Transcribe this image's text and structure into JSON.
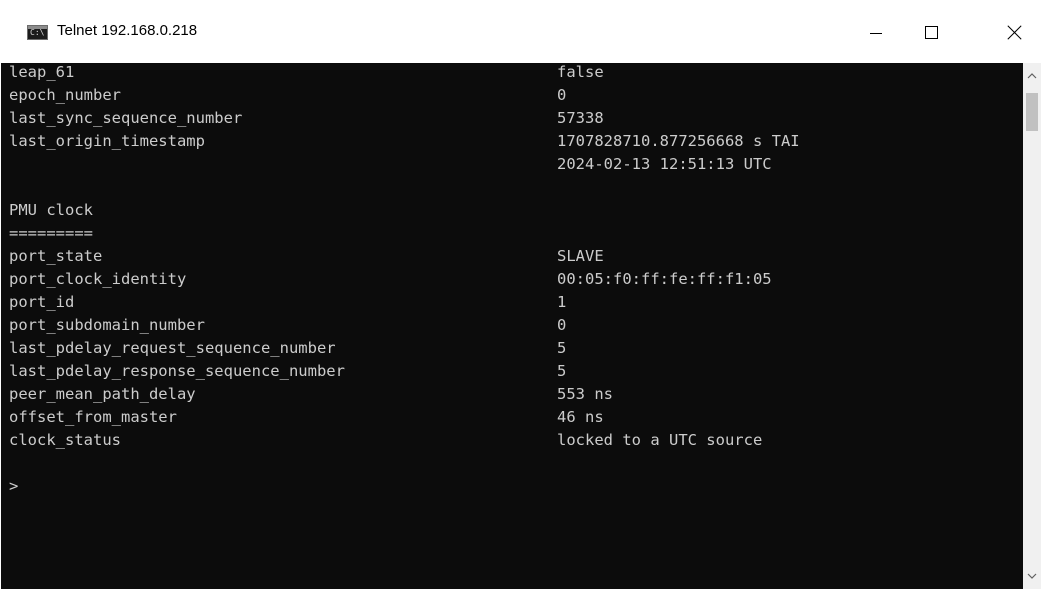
{
  "window": {
    "title": "Telnet 192.168.0.218",
    "icon": "console-icon",
    "icon_label": "C:\\"
  },
  "console": {
    "background": "#0c0c0c",
    "foreground": "#cccccc",
    "rows": [
      {
        "key": "leap_61",
        "value": "false"
      },
      {
        "key": "epoch_number",
        "value": "0"
      },
      {
        "key": "last_sync_sequence_number",
        "value": "57338"
      },
      {
        "key": "last_origin_timestamp",
        "value": "1707828710.877256668 s TAI"
      },
      {
        "key": "",
        "value": "2024-02-13 12:51:13 UTC"
      },
      {
        "key": "",
        "value": ""
      },
      {
        "key": "PMU clock",
        "value": ""
      },
      {
        "key": "=========",
        "value": ""
      },
      {
        "key": "port_state",
        "value": "SLAVE"
      },
      {
        "key": "port_clock_identity",
        "value": "00:05:f0:ff:fe:ff:f1:05"
      },
      {
        "key": "port_id",
        "value": "1"
      },
      {
        "key": "port_subdomain_number",
        "value": "0"
      },
      {
        "key": "last_pdelay_request_sequence_number",
        "value": "5"
      },
      {
        "key": "last_pdelay_response_sequence_number",
        "value": "5"
      },
      {
        "key": "peer_mean_path_delay",
        "value": "553 ns"
      },
      {
        "key": "offset_from_master",
        "value": "46 ns"
      },
      {
        "key": "clock_status",
        "value": "locked to a UTC source"
      },
      {
        "key": "",
        "value": ""
      },
      {
        "key": ">",
        "value": ""
      }
    ]
  }
}
